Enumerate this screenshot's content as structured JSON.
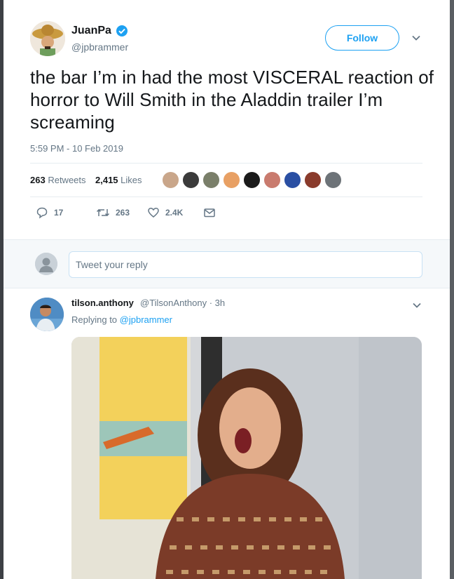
{
  "tweet": {
    "author_name": "JuanPa",
    "author_handle": "@jpbrammer",
    "follow_label": "Follow",
    "text": "the bar I’m in had the most VISCERAL reaction of horror to Will Smith in the Aladdin trailer I’m screaming",
    "timestamp": "5:59 PM - 10 Feb 2019",
    "retweets_count": "263",
    "retweets_label": "Retweets",
    "likes_count": "2,415",
    "likes_label": "Likes"
  },
  "actions": {
    "replies": "17",
    "retweets": "263",
    "likes": "2.4K"
  },
  "reply_box": {
    "placeholder": "Tweet your reply"
  },
  "reply": {
    "author_name": "tilson.anthony",
    "author_handle": "@TilsonAnthony",
    "time": "· 3h",
    "replying_prefix": "Replying to",
    "replying_to": "@jpbrammer"
  },
  "colors": {
    "accent": "#1da1f2",
    "muted": "#657786",
    "text": "#14171a"
  },
  "icons": [
    "verified-icon",
    "chevron-down-icon",
    "reply-icon",
    "retweet-icon",
    "like-icon",
    "dm-icon",
    "default-avatar-icon"
  ]
}
